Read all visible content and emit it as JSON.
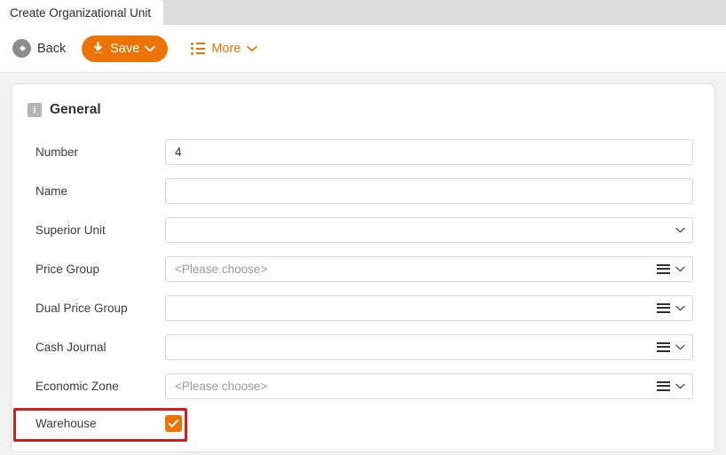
{
  "tab": {
    "label": "Create Organizational Unit"
  },
  "toolbar": {
    "back_label": "Back",
    "save_label": "Save",
    "more_label": "More",
    "back_icon": "arrow-left-circle-icon",
    "save_icon": "save-download-icon",
    "more_icon": "bulleted-list-icon",
    "accent_color": "#ec7404"
  },
  "panel": {
    "title": "General",
    "icon": "info-icon"
  },
  "form": {
    "rows": [
      {
        "label": "Number",
        "value": "4",
        "placeholder": "",
        "control": "text",
        "has_menu": false,
        "has_chevron": false
      },
      {
        "label": "Name",
        "value": "",
        "placeholder": "",
        "control": "text",
        "has_menu": false,
        "has_chevron": false
      },
      {
        "label": "Superior Unit",
        "value": "",
        "placeholder": "",
        "control": "select",
        "has_menu": false,
        "has_chevron": true
      },
      {
        "label": "Price Group",
        "value": "",
        "placeholder": "<Please choose>",
        "control": "select",
        "has_menu": true,
        "has_chevron": true
      },
      {
        "label": "Dual Price Group",
        "value": "",
        "placeholder": "",
        "control": "select",
        "has_menu": true,
        "has_chevron": true
      },
      {
        "label": "Cash Journal",
        "value": "",
        "placeholder": "",
        "control": "select",
        "has_menu": true,
        "has_chevron": true
      },
      {
        "label": "Economic Zone",
        "value": "",
        "placeholder": "<Please choose>",
        "control": "select",
        "has_menu": true,
        "has_chevron": true
      }
    ],
    "warehouse": {
      "label": "Warehouse",
      "checked": true,
      "checkbox_color": "#ec7404"
    }
  },
  "annotation": {
    "color": "#d01f1f",
    "target": "warehouse-row"
  }
}
